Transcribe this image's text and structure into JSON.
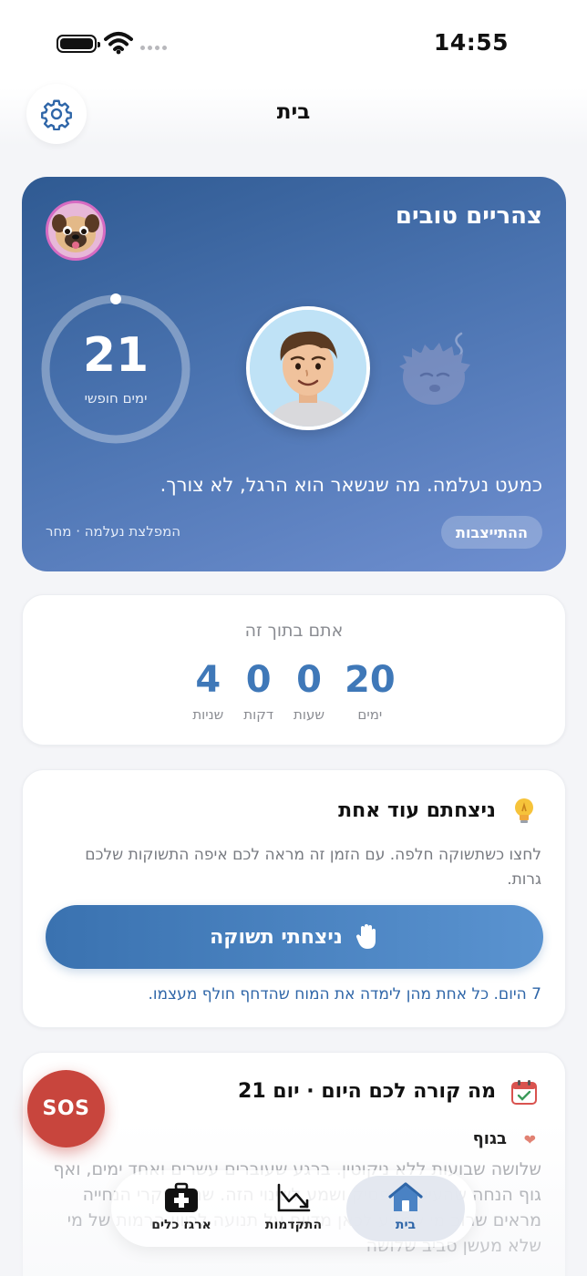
{
  "status_bar": {
    "time": "14:55"
  },
  "header": {
    "title": "בית"
  },
  "hero": {
    "greeting": "צהריים טובים",
    "ring_value": "21",
    "ring_label": "ימים חופשי",
    "ring_progress": 0.0,
    "message": "כמעט נעלמה. מה שנשאר הוא הרגל, לא צורך.",
    "stable_label": "ההתייצבות",
    "footer": "המפלצת נעלמה · מחר"
  },
  "timer": {
    "title": "אתם בתוך זה",
    "units": [
      {
        "value": "20",
        "label": "ימים"
      },
      {
        "value": "0",
        "label": "שעות"
      },
      {
        "value": "0",
        "label": "דקות"
      },
      {
        "value": "4",
        "label": "שניות"
      }
    ]
  },
  "won": {
    "title": "ניצחתם עוד אחת",
    "description": "לחצו כשתשוקה חלפה. עם הזמן זה מראה לכם איפה התשוקות שלכם גרות.",
    "button_label": "ניצחתי תשוקה",
    "count_text": "7 היום. כל אחת מהן לימדה את המוח שהדחף חולף מעצמו."
  },
  "today": {
    "title": "מה קורה לכם היום · יום 21",
    "section_title": "בגוף",
    "text": "שלושה שבועות ללא ניקוטין. ברגע שעוברים עשרים ואחד ימים, ואף גוף הנחה שהעישון הפסיק ושמע לשינוי הזה. שני מחקרי הנחייה מראים שרוב מי שמגיע לכאן מדווח על תנועה לכיוון הרמות של מי שלא מעשן סביב שלושה"
  },
  "sos": {
    "label": "SOS"
  },
  "nav": {
    "items": [
      {
        "label": "ארגז כלים",
        "icon": "first-aid-kit-icon"
      },
      {
        "label": "התקדמות",
        "icon": "chart-icon"
      },
      {
        "label": "בית",
        "icon": "home-icon"
      }
    ]
  },
  "colors": {
    "accent": "#3f78b8",
    "sos": "#c8453d",
    "hero_start": "#2f5a92",
    "hero_end": "#6f8fd0"
  }
}
